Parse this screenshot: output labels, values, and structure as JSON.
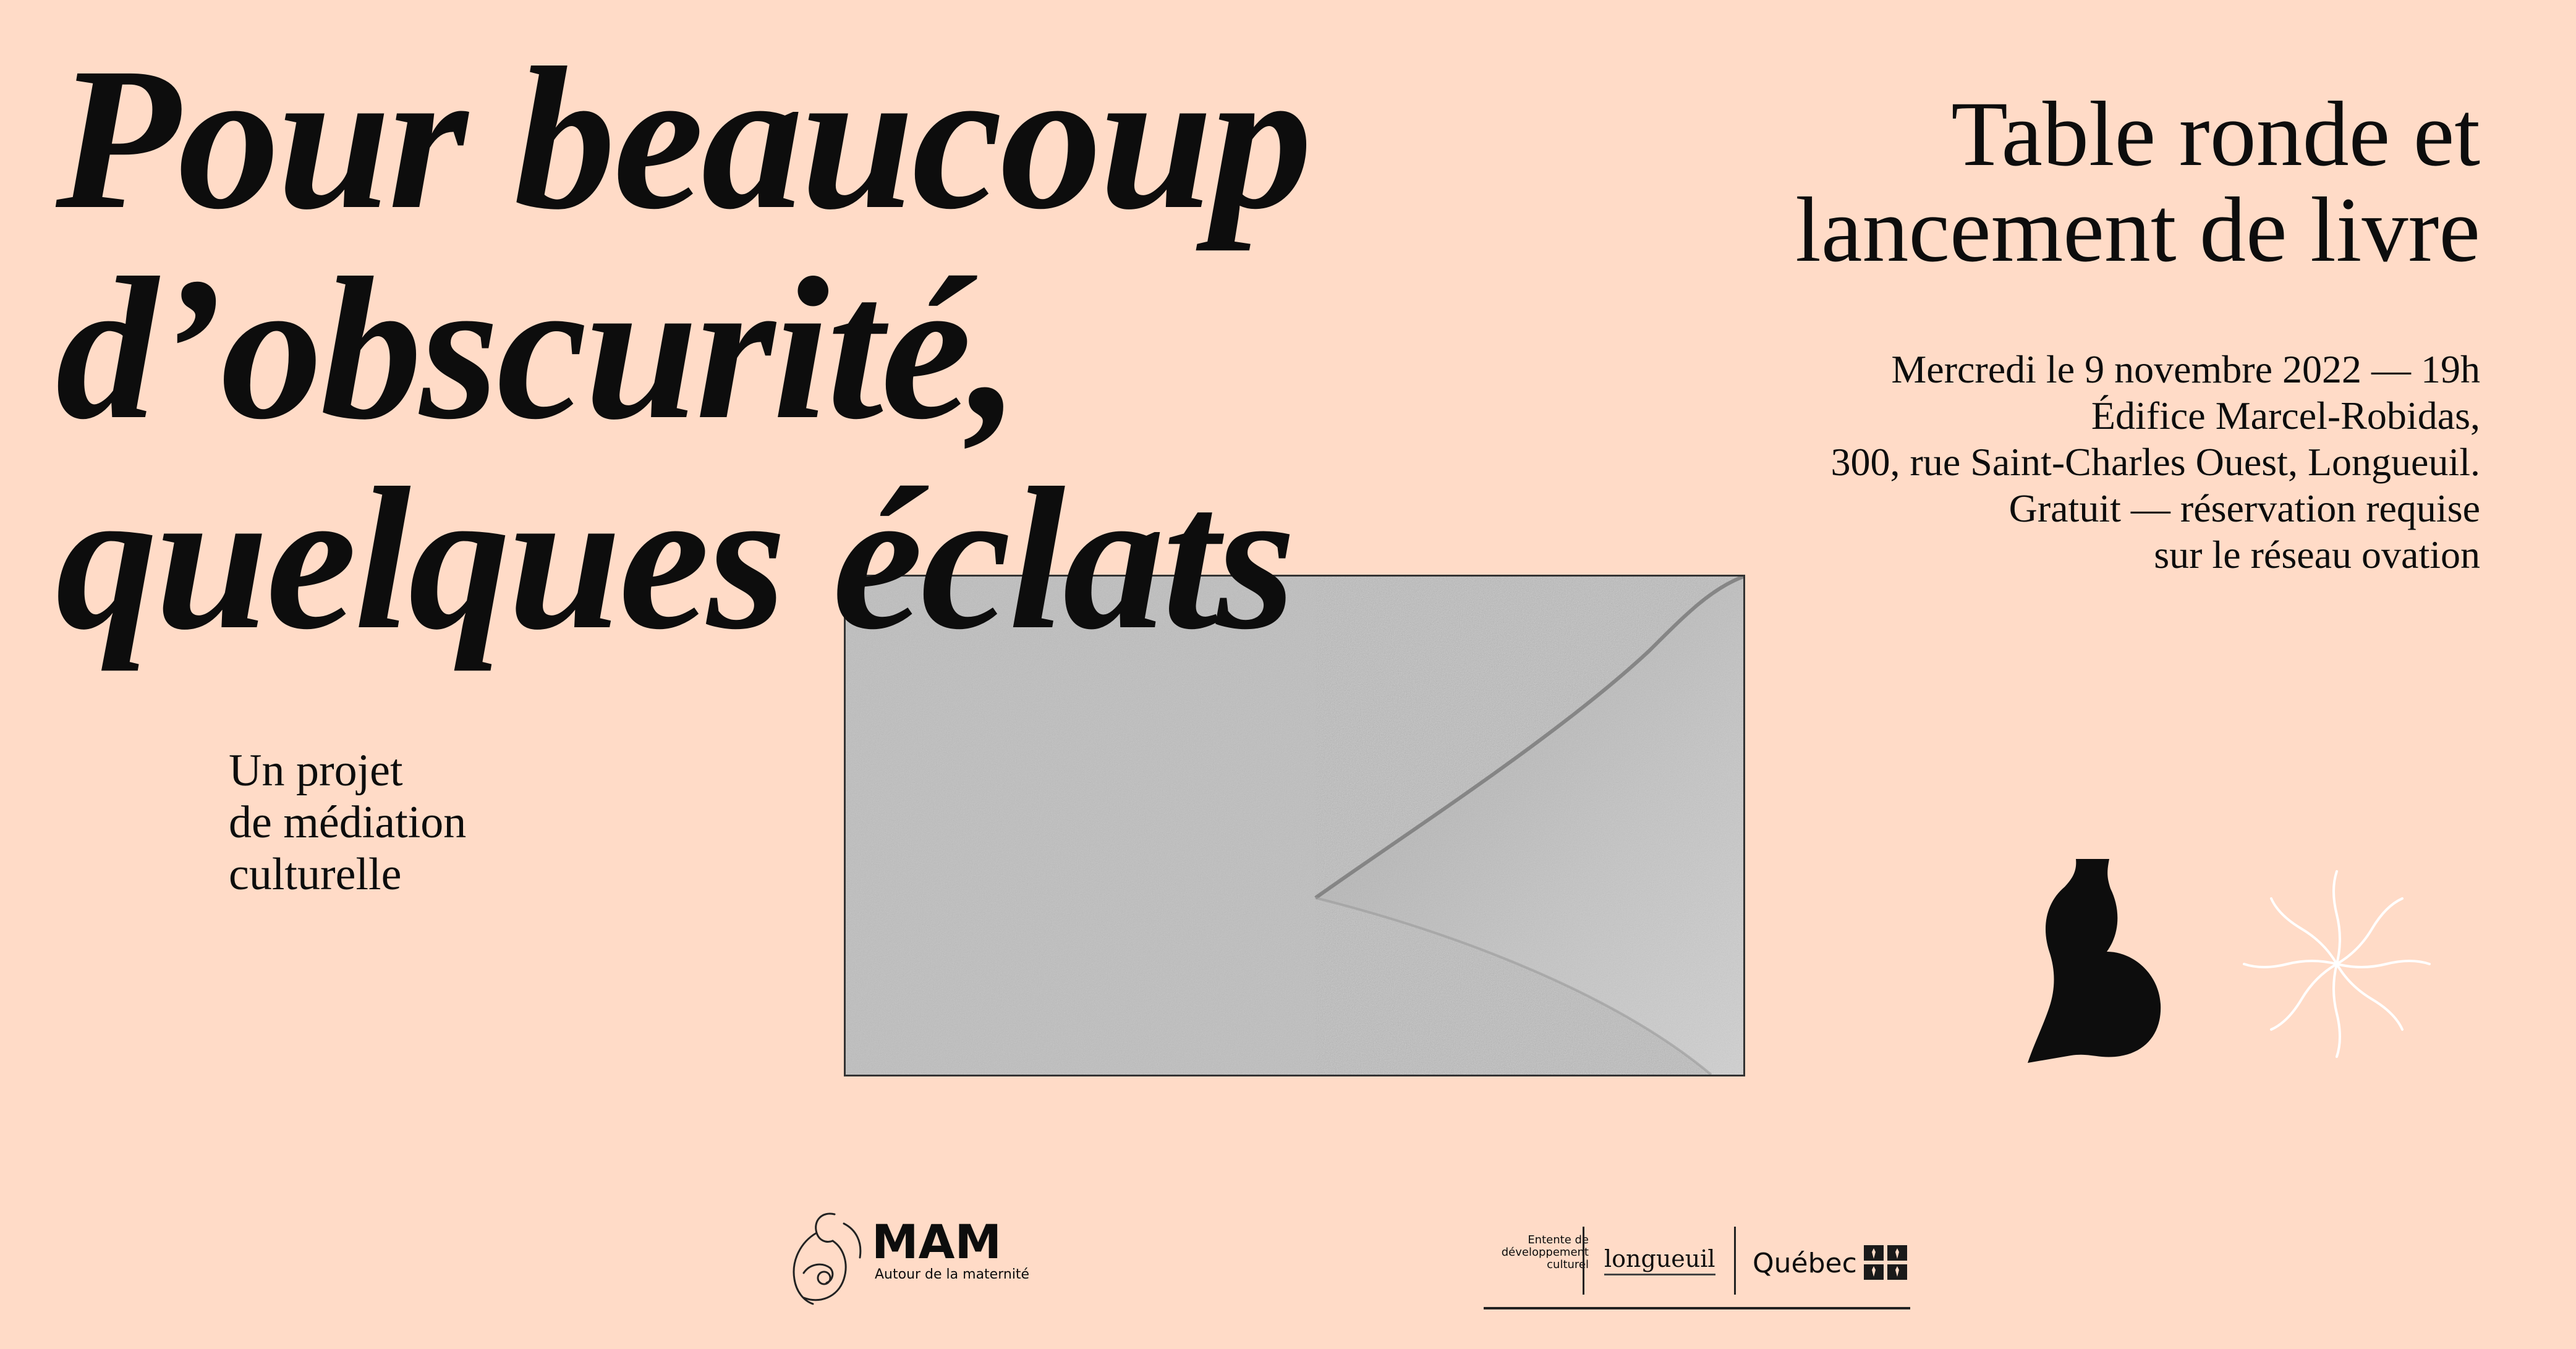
{
  "title_lines": [
    "Pour beaucoup",
    "d’obscurité,",
    "quelques éclats"
  ],
  "subtitle_lines": [
    "Un projet",
    "de médiation",
    "culturelle"
  ],
  "event_title_lines": [
    "Table ronde et",
    "lancement de livre"
  ],
  "event_info_lines": [
    "Mercredi le 9 novembre 2022 — 19h",
    "Édifice Marcel-Robidas,",
    "300, rue Saint-Charles Ouest, Longueuil.",
    "Gratuit — réservation requise",
    "sur le réseau ovation"
  ],
  "logos": {
    "mam_name": "MAM",
    "mam_tagline": "Autour de la maternité",
    "entente_lines": [
      "Entente de",
      "développement",
      "culturel"
    ],
    "longueuil": "longueuil",
    "quebec": "Québec"
  },
  "colors": {
    "background": "#FFDBC7",
    "text": "#0d0d0d",
    "envelope": "#bdbdbd",
    "sun_icon": "#ffffff"
  },
  "icons": [
    "pregnant-silhouette-icon",
    "sun-squiggle-icon",
    "quebec-flag-icon",
    "mam-logo-icon"
  ]
}
